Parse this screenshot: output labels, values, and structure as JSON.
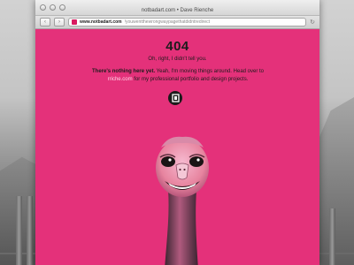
{
  "window": {
    "title": "notbadart.com • Dave Rienche"
  },
  "toolbar": {
    "back_icon": "chevron-left-icon",
    "forward_icon": "chevron-right-icon",
    "url_host": "www.notbadart.com",
    "url_path": "/youwentthewrongwaypagethatdidntredirect",
    "reload_icon": "reload-icon"
  },
  "page": {
    "heading": "404",
    "subheading": "Oh, right, I didn't tell you.",
    "para_bold": "There's nothing here yet.",
    "para_text1": " Yeah, I'm moving things around. Head over to ",
    "para_link": "rriche.com",
    "para_text2": " for my professional portfolio and design projects.",
    "logo_icon": "brand-logo-icon",
    "illustration": "ostrich-illustration"
  },
  "colors": {
    "page_background": "#e4317a",
    "text": "#1c1c1c",
    "link": "#ffd6e6"
  }
}
